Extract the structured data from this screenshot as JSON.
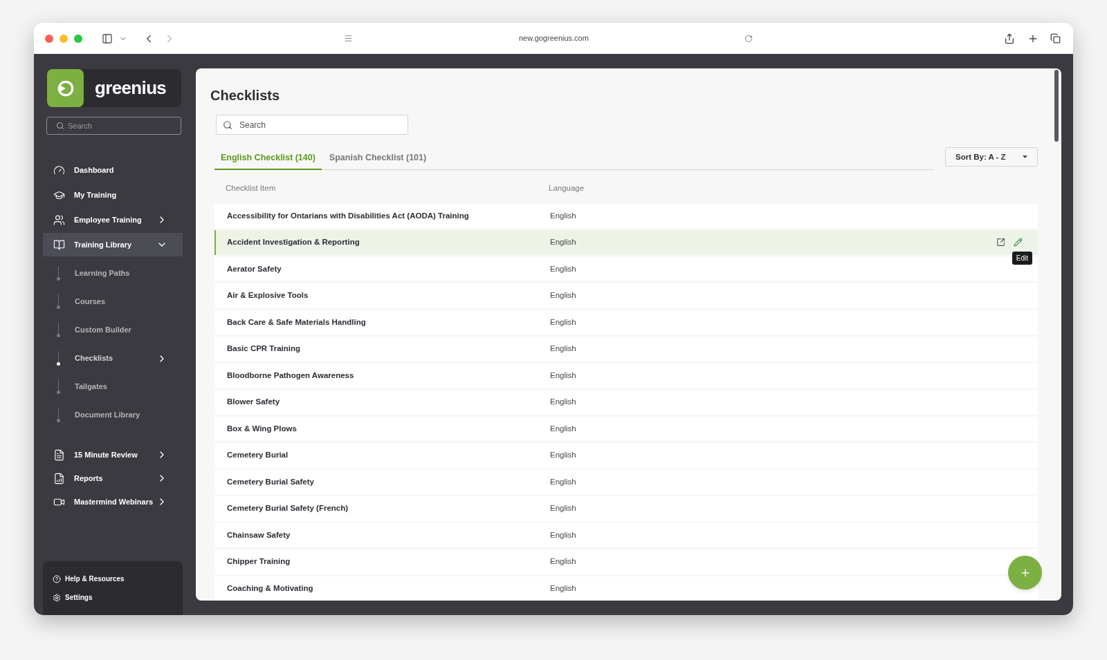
{
  "browser": {
    "url": "new.gogreenius.com"
  },
  "sidebar": {
    "logo_text": "greenius",
    "search": {
      "placeholder": "Search"
    },
    "items": [
      {
        "label": "Dashboard",
        "kind": "link"
      },
      {
        "label": "My Training",
        "kind": "link"
      },
      {
        "label": "Employee Training",
        "kind": "group",
        "expanded": false
      },
      {
        "label": "Training Library",
        "kind": "group",
        "expanded": true,
        "children": [
          {
            "label": "Learning Paths",
            "selected": false,
            "has_submenu": false
          },
          {
            "label": "Courses",
            "selected": false,
            "has_submenu": false
          },
          {
            "label": "Custom Builder",
            "selected": false,
            "has_submenu": false
          },
          {
            "label": "Checklists",
            "selected": true,
            "has_submenu": true
          },
          {
            "label": "Tailgates",
            "selected": false,
            "has_submenu": false
          },
          {
            "label": "Document Library",
            "selected": false,
            "has_submenu": false
          }
        ]
      },
      {
        "label": "15 Minute Review",
        "kind": "group",
        "expanded": false
      },
      {
        "label": "Reports",
        "kind": "group",
        "expanded": false
      },
      {
        "label": "Mastermind Webinars",
        "kind": "group",
        "expanded": false
      }
    ],
    "footer": [
      "Help & Resources",
      "Settings"
    ]
  },
  "page": {
    "title": "Checklists",
    "search": {
      "placeholder": "Search"
    },
    "tabs": [
      {
        "label": "English Checklist (140)",
        "selected": true
      },
      {
        "label": "Spanish Checklist (101)",
        "selected": false
      }
    ],
    "sort": "Sort By: A - Z"
  },
  "table": {
    "columns": [
      "Checklist Item",
      "Language"
    ],
    "tooltip": "Edit",
    "rows": [
      {
        "item": "Accessibility for Ontarians with Disabilities Act (AODA) Training",
        "language": "English",
        "selected": false
      },
      {
        "item": "Accident Investigation & Reporting",
        "language": "English",
        "selected": true
      },
      {
        "item": "Aerator Safety",
        "language": "English",
        "selected": false
      },
      {
        "item": "Air & Explosive Tools",
        "language": "English",
        "selected": false
      },
      {
        "item": "Back Care & Safe Materials Handling",
        "language": "English",
        "selected": false
      },
      {
        "item": "Basic CPR Training",
        "language": "English",
        "selected": false
      },
      {
        "item": "Bloodborne Pathogen Awareness",
        "language": "English",
        "selected": false
      },
      {
        "item": "Blower Safety",
        "language": "English",
        "selected": false
      },
      {
        "item": "Box & Wing Plows",
        "language": "English",
        "selected": false
      },
      {
        "item": "Cemetery Burial",
        "language": "English",
        "selected": false
      },
      {
        "item": "Cemetery Burial Safety",
        "language": "English",
        "selected": false
      },
      {
        "item": "Cemetery Burial Safety (French)",
        "language": "English",
        "selected": false
      },
      {
        "item": "Chainsaw Safety",
        "language": "English",
        "selected": false
      },
      {
        "item": "Chipper Training",
        "language": "English",
        "selected": false
      },
      {
        "item": "Coaching & Motivating",
        "language": "English",
        "selected": false
      }
    ]
  }
}
